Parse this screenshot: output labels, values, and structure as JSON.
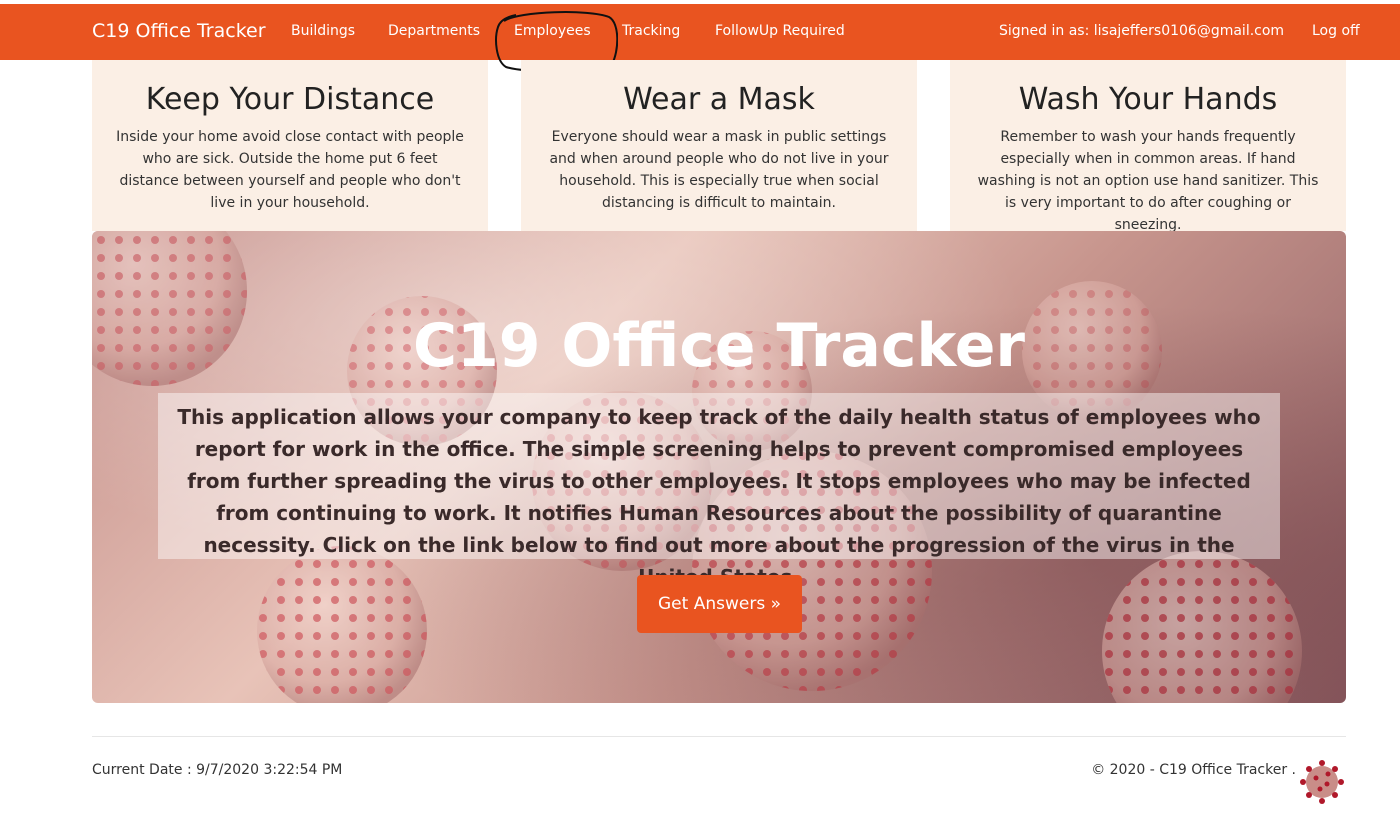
{
  "navbar": {
    "brand": "C19 Office Tracker",
    "links": [
      {
        "label": "Buildings"
      },
      {
        "label": "Departments"
      },
      {
        "label": "Employees"
      },
      {
        "label": "Tracking"
      },
      {
        "label": "FollowUp Required"
      }
    ],
    "signed_in": "Signed in as: lisajeffers0106@gmail.com",
    "logoff": "Log off",
    "color": "#e95420"
  },
  "cards": [
    {
      "title": "Keep Your Distance",
      "text": "Inside your home avoid close contact with people who are sick. Outside the home put 6 feet distance between yourself and people who don't live in your household."
    },
    {
      "title": "Wear a Mask",
      "text": "Everyone should wear a mask in public settings and when around people who do not live in your household. This is especially true when social distancing is difficult to maintain."
    },
    {
      "title": "Wash Your Hands",
      "text": "Remember to wash your hands frequently especially when in common areas. If hand washing is not an option use hand sanitizer. This is very important to do after coughing or sneezing."
    }
  ],
  "hero": {
    "title": "C19 Office Tracker",
    "description": "This application allows your company to keep track of the daily health status of employees who report for work in the office. The simple screening helps to prevent compromised employees from further spreading the virus to other employees. It stops employees who may be infected from continuing to work. It notifies Human Resources about the possibility of quarantine necessity. Click on the link below to find out more about the progression of the virus in the United States.",
    "button": "Get Answers »"
  },
  "footer": {
    "current_date": "Current Date : 9/7/2020 3:22:54 PM",
    "copyright": "© 2020 - C19 Office Tracker ."
  }
}
